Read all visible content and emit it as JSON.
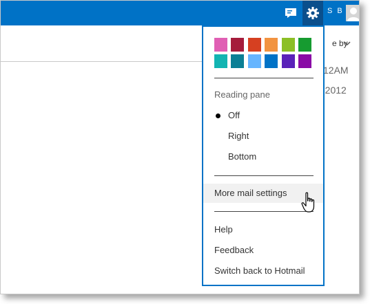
{
  "header": {
    "user_initials": "S B",
    "icons": [
      "chat-icon",
      "gear-icon",
      "user-avatar-icon"
    ]
  },
  "list": {
    "sort_label": "e by",
    "time_1": "12AM",
    "time_2": "-2012"
  },
  "settings_menu": {
    "theme_colors": [
      "#e05fb4",
      "#a51c3c",
      "#d64021",
      "#f29340",
      "#8cbf26",
      "#169b30",
      "#13b4b2",
      "#0b7f95",
      "#66b5ff",
      "#0072c6",
      "#5a22b9",
      "#8a0aa6"
    ],
    "reading_pane_label": "Reading pane",
    "reading_pane_options": [
      {
        "label": "Off",
        "selected": true
      },
      {
        "label": "Right",
        "selected": false
      },
      {
        "label": "Bottom",
        "selected": false
      }
    ],
    "more_settings": "More mail settings",
    "help": "Help",
    "feedback": "Feedback",
    "switch_back": "Switch back to Hotmail"
  },
  "colors": {
    "header_blue": "#0072c6",
    "gear_active": "#0a4f8c"
  }
}
